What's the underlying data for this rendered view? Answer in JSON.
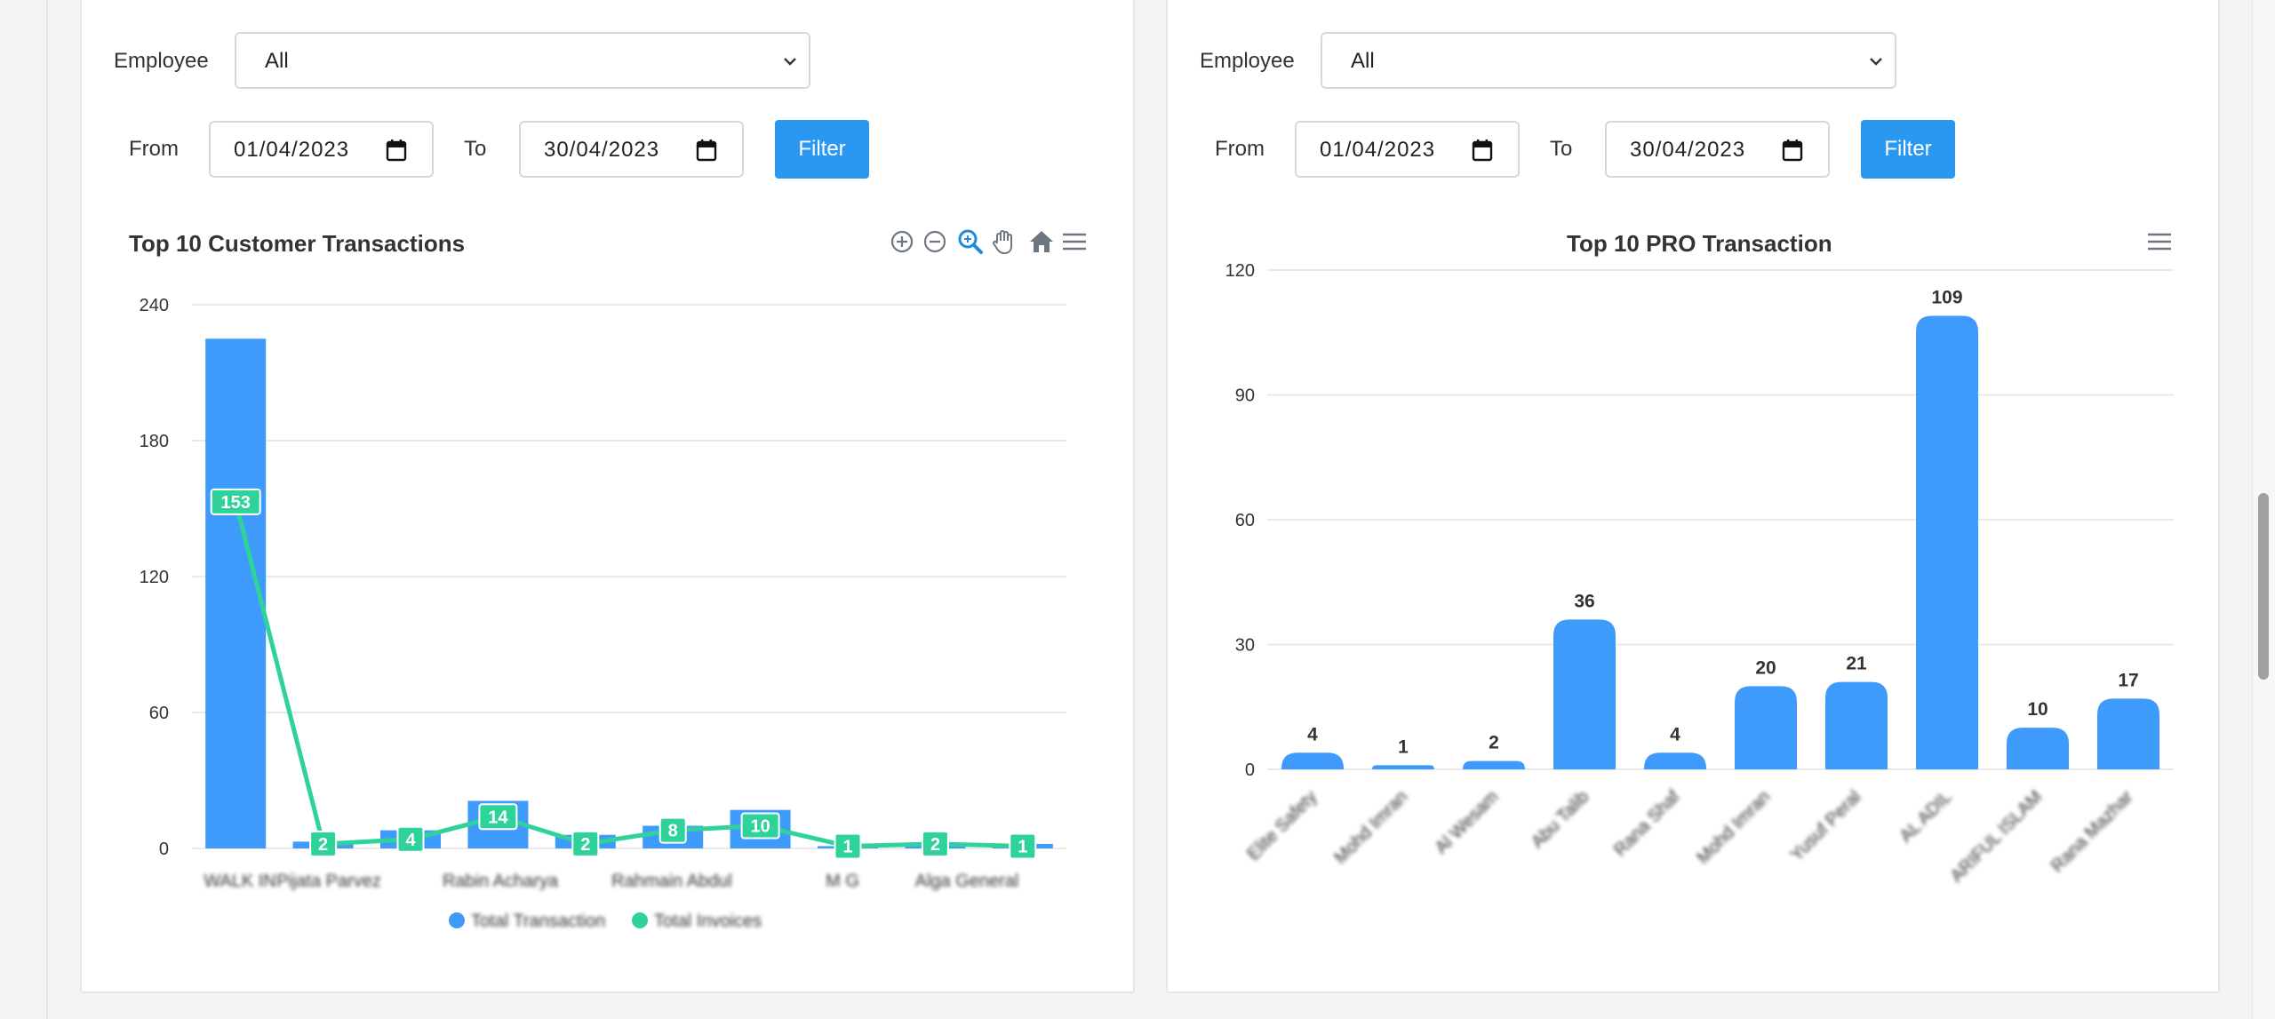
{
  "left_panel": {
    "employee_label": "Employee",
    "employee_value": "All",
    "from_label": "From",
    "from_value": "01/04/2023",
    "to_label": "To",
    "to_value": "30/04/2023",
    "filter_label": "Filter",
    "chart_title": "Top 10 Customer Transactions",
    "toolbar_icons": [
      "zoom-in-icon",
      "zoom-out-icon",
      "selection-zoom-icon",
      "pan-hand-icon",
      "home-reset-icon",
      "menu-icon"
    ]
  },
  "right_panel": {
    "employee_label": "Employee",
    "employee_value": "All",
    "from_label": "From",
    "from_value": "01/04/2023",
    "to_label": "To",
    "to_value": "30/04/2023",
    "filter_label": "Filter",
    "chart_title": "Top 10 PRO Transaction",
    "toolbar_icons": [
      "menu-icon"
    ]
  },
  "colors": {
    "accent_blue": "#3f9bfb",
    "accent_green": "#2fd39a",
    "button_blue": "#2a97f0"
  },
  "chart_data": [
    {
      "type": "bar",
      "title": "Top 10 Customer Transactions",
      "categories": [
        "WALK IN",
        "Pijata Parvez",
        "",
        "Rabin Acharya",
        "",
        "Rahmain Abdul",
        "",
        "M G",
        "Alga General",
        ""
      ],
      "series": [
        {
          "name": "Total Transaction",
          "type": "bar",
          "values": [
            225,
            3,
            8,
            21,
            6,
            10,
            17,
            1,
            1,
            2
          ]
        },
        {
          "name": "Total Invoices",
          "type": "line",
          "values": [
            153,
            2,
            4,
            14,
            2,
            8,
            10,
            1,
            2,
            1
          ]
        }
      ],
      "ylim": [
        0,
        240
      ],
      "yticks": [
        0,
        60,
        120,
        180,
        240
      ],
      "grid": true,
      "legend": "bottom"
    },
    {
      "type": "bar",
      "title": "Top 10 PRO Transaction",
      "categories": [
        "Elite Safety",
        "Mohd Imran",
        "Al Wesam",
        "Abu Talib",
        "Rana Shaf",
        "Mohd Imran",
        "Yusuf Peral",
        "AL ADIL",
        "ARIFUL ISLAM",
        "Rana Mazhar"
      ],
      "values": [
        4,
        1,
        2,
        36,
        4,
        20,
        21,
        109,
        10,
        17
      ],
      "ylim": [
        0,
        120
      ],
      "yticks": [
        0,
        30,
        60,
        90,
        120
      ],
      "grid": true
    }
  ]
}
